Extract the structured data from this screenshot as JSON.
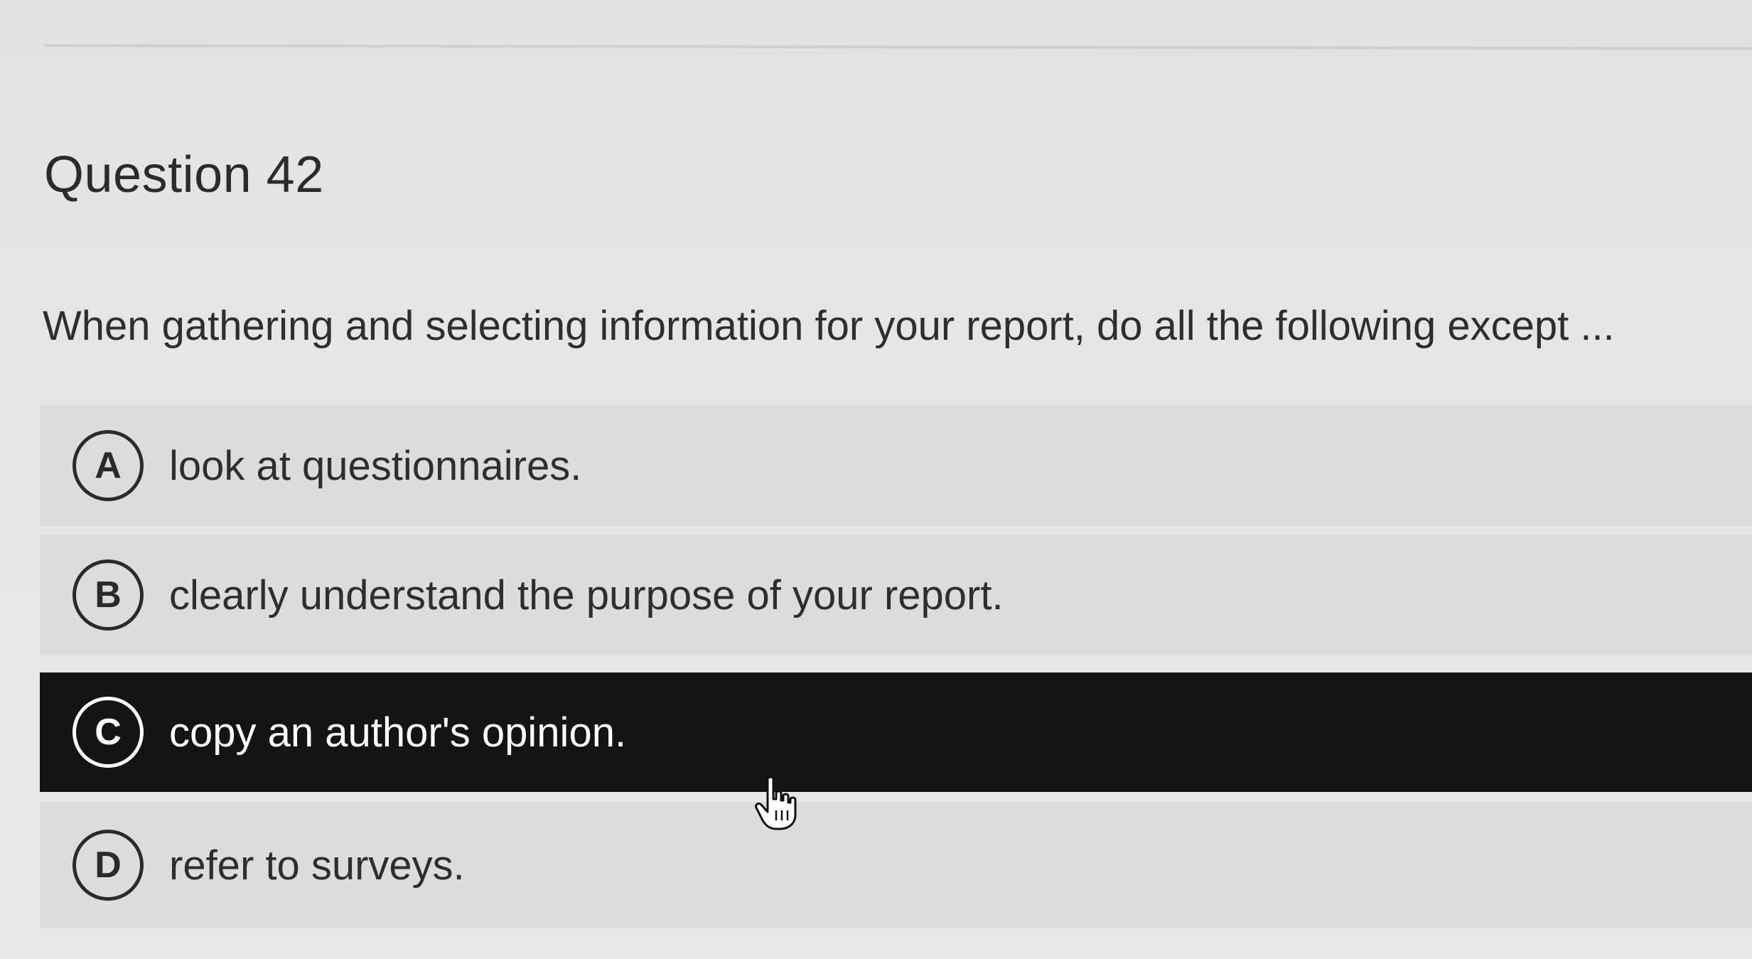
{
  "question": {
    "title": "Question 42",
    "prompt": "When gathering and selecting information for your report, do all the following except ..."
  },
  "options": [
    {
      "letter": "A",
      "label": "look at questionnaires.",
      "selected": false
    },
    {
      "letter": "B",
      "label": "clearly understand the purpose of your report.",
      "selected": false
    },
    {
      "letter": "C",
      "label": "copy an author's opinion.",
      "selected": true
    },
    {
      "letter": "D",
      "label": "refer to surveys.",
      "selected": false
    }
  ],
  "colors": {
    "selected_background": "#141414",
    "option_background": "#dcdcda",
    "page_background": "#e4e4e2",
    "text": "#2e2e2e"
  },
  "cursor": {
    "icon": "hand-pointer-icon"
  }
}
